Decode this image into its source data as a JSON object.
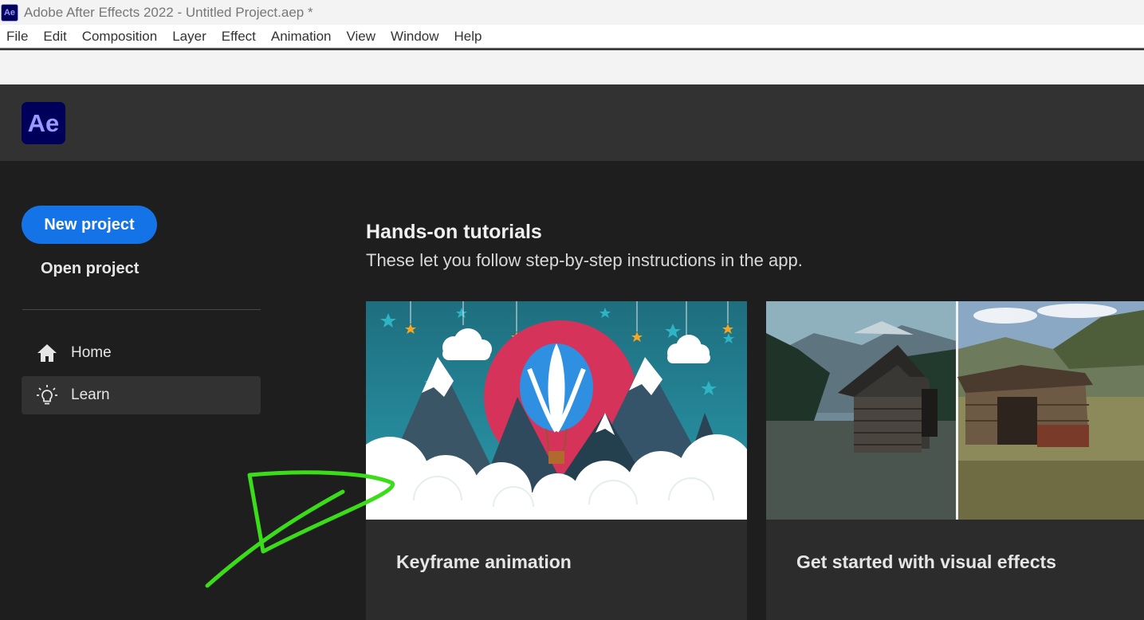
{
  "window": {
    "app_icon": "Ae",
    "title": "Adobe After Effects 2022 - Untitled Project.aep *"
  },
  "menubar": {
    "items": [
      "File",
      "Edit",
      "Composition",
      "Layer",
      "Effect",
      "Animation",
      "View",
      "Window",
      "Help"
    ]
  },
  "header": {
    "logo": "Ae"
  },
  "sidebar": {
    "new_project": "New project",
    "open_project": "Open project",
    "nav": [
      {
        "label": "Home",
        "icon": "home-icon"
      },
      {
        "label": "Learn",
        "icon": "lightbulb-icon",
        "selected": true
      }
    ]
  },
  "content": {
    "section_title": "Hands-on tutorials",
    "section_subtitle": "These let you follow step-by-step instructions in the app.",
    "cards": [
      {
        "title": "Keyframe animation"
      },
      {
        "title": "Get started with visual effects"
      }
    ]
  },
  "colors": {
    "accent_blue": "#1473e6",
    "ae_purple": "#9999ff",
    "ae_navy": "#00005b",
    "annotation_green": "#3bdc1a"
  }
}
